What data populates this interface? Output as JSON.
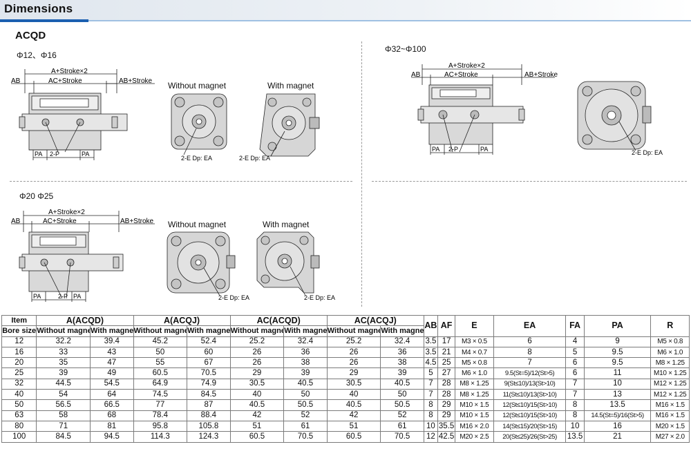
{
  "header": {
    "title": "Dimensions"
  },
  "model": "ACQD",
  "sections": {
    "s1": {
      "label": "Φ12、Φ16"
    },
    "s2": {
      "label": "Φ32~Φ100"
    },
    "s3": {
      "label": "Φ20  Φ25"
    }
  },
  "views": {
    "without_magnet": "Without magnet",
    "with_magnet": "With magnet",
    "callout": "2-E Dp: EA"
  },
  "dims": {
    "a": "A+Stroke×2",
    "ac": "AC+Stroke",
    "ab": "AB",
    "ab_stroke": "AB+Stroke",
    "pa": "PA",
    "p": "2-P"
  },
  "table": {
    "corner_top": "Item",
    "corner_bottom": "Bore size",
    "group_headers": [
      "A(ACQD)",
      "A(ACQJ)",
      "AC(ACQD)",
      "AC(ACQJ)",
      "AB",
      "AF",
      "E",
      "EA",
      "FA",
      "PA",
      "R"
    ],
    "sub_headers": [
      "Without magnet",
      "With magnet",
      "Without magnet",
      "With magnet",
      "Without magnet",
      "With magnet",
      "Without magnet",
      "With magnet"
    ],
    "rows": [
      [
        "12",
        "32.2",
        "39.4",
        "45.2",
        "52.4",
        "25.2",
        "32.4",
        "25.2",
        "32.4",
        "3.5",
        "17",
        "M3 × 0.5",
        "6",
        "4",
        "9",
        "M5 × 0.8"
      ],
      [
        "16",
        "33",
        "43",
        "50",
        "60",
        "26",
        "36",
        "26",
        "36",
        "3.5",
        "21",
        "M4 × 0.7",
        "8",
        "5",
        "9.5",
        "M6 × 1.0"
      ],
      [
        "20",
        "35",
        "47",
        "55",
        "67",
        "26",
        "38",
        "26",
        "38",
        "4.5",
        "25",
        "M5 × 0.8",
        "7",
        "6",
        "9.5",
        "M8 × 1.25"
      ],
      [
        "25",
        "39",
        "49",
        "60.5",
        "70.5",
        "29",
        "39",
        "29",
        "39",
        "5",
        "27",
        "M6 × 1.0",
        "9.5(St=5)/12(St>5)",
        "6",
        "11",
        "M10 × 1.25"
      ],
      [
        "32",
        "44.5",
        "54.5",
        "64.9",
        "74.9",
        "30.5",
        "40.5",
        "30.5",
        "40.5",
        "7",
        "28",
        "M8 × 1.25",
        "9(St≤10)/13(St>10)",
        "7",
        "10",
        "M12 × 1.25"
      ],
      [
        "40",
        "54",
        "64",
        "74.5",
        "84.5",
        "40",
        "50",
        "40",
        "50",
        "7",
        "28",
        "M8 × 1.25",
        "11(St≤10)/13(St>10)",
        "7",
        "13",
        "M12 × 1.25"
      ],
      [
        "50",
        "56.5",
        "66.5",
        "77",
        "87",
        "40.5",
        "50.5",
        "40.5",
        "50.5",
        "8",
        "29",
        "M10 × 1.5",
        "12(St≤10)/15(St>10)",
        "8",
        "13.5",
        "M16 × 1.5"
      ],
      [
        "63",
        "58",
        "68",
        "78.4",
        "88.4",
        "42",
        "52",
        "42",
        "52",
        "8",
        "29",
        "M10 × 1.5",
        "12(St≤10)/15(St>10)",
        "8",
        "14.5(St=5)/16(St>5)",
        "M16 × 1.5"
      ],
      [
        "80",
        "71",
        "81",
        "95.8",
        "105.8",
        "51",
        "61",
        "51",
        "61",
        "10",
        "35.5",
        "M16 × 2.0",
        "14(St≤15)/20(St>15)",
        "10",
        "16",
        "M20 × 1.5"
      ],
      [
        "100",
        "84.5",
        "94.5",
        "114.3",
        "124.3",
        "60.5",
        "70.5",
        "60.5",
        "70.5",
        "12",
        "42.5",
        "M20 × 2.5",
        "20(St≤25)/26(St>25)",
        "13.5",
        "21",
        "M27 × 2.0"
      ]
    ]
  }
}
